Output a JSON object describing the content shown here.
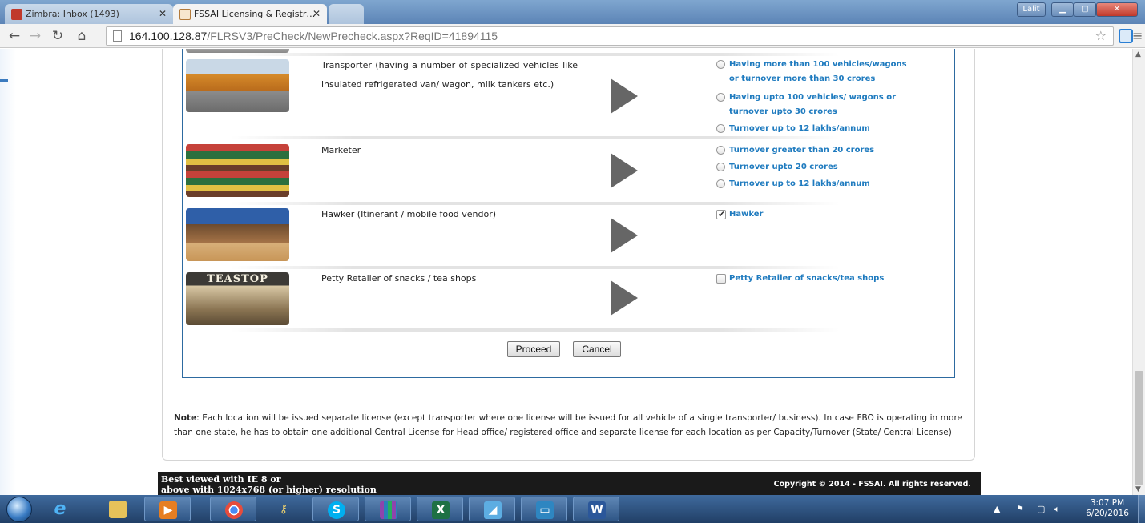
{
  "browser": {
    "tabs": [
      {
        "label": "Zimbra: Inbox (1493)",
        "active": false
      },
      {
        "label": "FSSAI Licensing & Registr…",
        "active": true
      }
    ],
    "user_button": "Lalit",
    "url_host": "164.100.128.87",
    "url_path": "/FLRSV3/PreCheck/NewPrecheck.aspx?ReqID=41894115"
  },
  "categories": [
    {
      "description": "Transporter (having a number of specialized vehicles like insulated refrigerated van/ wagon, milk tankers etc.)",
      "image_icon": "trucks-image",
      "options": [
        {
          "type": "radio",
          "checked": false,
          "label": "Having more than 100 vehicles/wagons",
          "label2": "or turnover more than 30 crores"
        },
        {
          "type": "radio",
          "checked": false,
          "label": "Having upto 100 vehicles/ wagons or",
          "label2": "turnover upto 30 crores"
        },
        {
          "type": "radio",
          "checked": false,
          "label": "Turnover up to 12 lakhs/annum"
        }
      ]
    },
    {
      "description": "Marketer",
      "image_icon": "supermarket-shelves-image",
      "options": [
        {
          "type": "radio",
          "checked": false,
          "label": "Turnover greater than 20 crores"
        },
        {
          "type": "radio",
          "checked": false,
          "label": "Turnover upto 20 crores"
        },
        {
          "type": "radio",
          "checked": false,
          "label": "Turnover up to 12 lakhs/annum"
        }
      ]
    },
    {
      "description": "Hawker (Itinerant / mobile food vendor)",
      "image_icon": "hawker-stall-image",
      "options": [
        {
          "type": "checkbox",
          "checked": true,
          "label": "Hawker"
        }
      ]
    },
    {
      "description": "Petty Retailer of snacks / tea shops",
      "image_icon": "tea-shop-image",
      "image_text": "TEASTOP",
      "options": [
        {
          "type": "checkbox",
          "checked": false,
          "label": "Petty Retailer of snacks/tea shops"
        }
      ]
    }
  ],
  "buttons": {
    "proceed": "Proceed",
    "cancel": "Cancel"
  },
  "note": {
    "label": "Note",
    "text": ": Each location will be issued separate license (except transporter where one license will be issued for all vehicle of a single transporter/ business). In case FBO is operating in more than one state, he has to obtain one additional Central License for Head office/ registered office and separate license for each location as per Capacity/Turnover (State/ Central License)"
  },
  "footer": {
    "left_line1": "Best viewed with IE 8 or",
    "left_line2": "above with 1024x768 (or higher) resolution",
    "right": "Copyright © 2014 - FSSAI. All rights reserved."
  },
  "taskbar": {
    "apps": [
      "internet-explorer",
      "file-explorer",
      "media-player",
      "chrome",
      "keys-app",
      "skype",
      "winrar",
      "excel",
      "outlook-app",
      "remote-desktop",
      "word"
    ],
    "time": "3:07 PM",
    "date": "6/20/2016"
  },
  "colors": {
    "accent": "#1f7bbf",
    "frame_border": "#2d6aa0",
    "footer_bg": "#1a1a1a"
  }
}
